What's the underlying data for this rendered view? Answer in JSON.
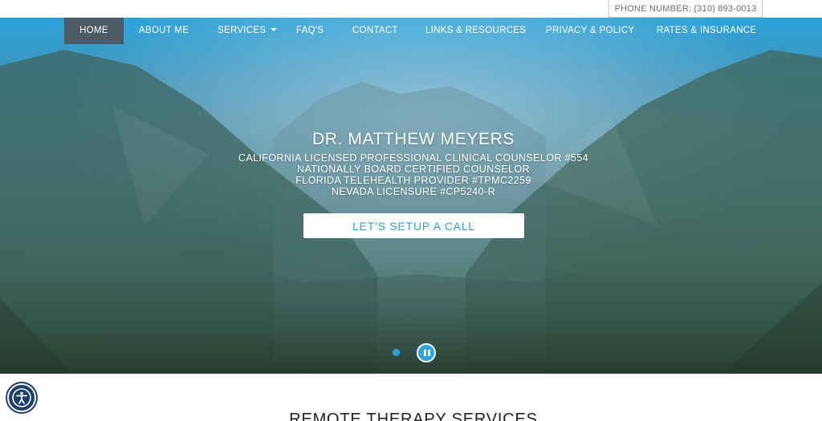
{
  "topbar": {
    "phone": "PHONE NUMBER: (310) 893-0013"
  },
  "nav": {
    "items": [
      {
        "label": "HOME",
        "active": true
      },
      {
        "label": "ABOUT ME"
      },
      {
        "label": "SERVICES",
        "has_dropdown": true
      },
      {
        "label": "FAQ'S"
      },
      {
        "label": "CONTACT"
      },
      {
        "label": "LINKS & RESOURCES"
      },
      {
        "label": "PRIVACY & POLICY"
      },
      {
        "label": "RATES & INSURANCE"
      }
    ]
  },
  "hero": {
    "name": "DR. MATTHEW MEYERS",
    "lines": [
      "CALIFORNIA LICENSED PROFESSIONAL CLINICAL COUNSELOR #554",
      "NATIONALLY BOARD CERTIFIED COUNSELOR",
      "FLORIDA TELEHEALTH PROVIDER #TPMC2259",
      "NEVADA LICENSURE #CP5240-R"
    ],
    "cta": "LET'S SETUP A CALL"
  },
  "slider": {
    "dot_icon": "slide-dot-icon",
    "pause_icon": "pause-icon"
  },
  "accessibility": {
    "icon": "accessibility-icon"
  },
  "section": {
    "title": "REMOTE THERAPY SERVICES"
  },
  "colors": {
    "accent": "#2aa5dd",
    "nav_active": "#4c5a66",
    "a11y": "#1c3f6e"
  }
}
